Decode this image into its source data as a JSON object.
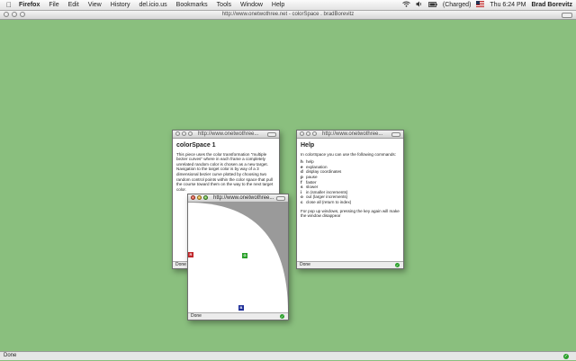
{
  "menubar": {
    "apple_icon": "",
    "items": [
      "Firefox",
      "File",
      "Edit",
      "View",
      "History",
      "del.icio.us",
      "Bookmarks",
      "Tools",
      "Window",
      "Help"
    ],
    "battery": "(Charged)",
    "clock": "Thu 6:24 PM",
    "user": "Brad Borevitz"
  },
  "main_window": {
    "title": "http://www.onetwothree.net - colorSpace . bradBorevitz",
    "status": "Done"
  },
  "info_popup": {
    "url": "http://www.onetwothree...",
    "heading": "colorSpace 1",
    "body": "This piece uses the color transformation \"multiple bezier curves\" where in each frame a completely unrelated random color is chosen as a new target. Navigation to the target color is by way of a 3 dimensional bezier curve plotted by choosing two random control points within the color space that pull the course toward them on the way to the next target color.",
    "status": "Done"
  },
  "help_popup": {
    "url": "http://www.onetwothree...",
    "heading": "Help",
    "intro": "In colorSpace you can use the following commands:",
    "commands": [
      {
        "key": "h",
        "desc": "help"
      },
      {
        "key": "e",
        "desc": "explanation"
      },
      {
        "key": "d",
        "desc": "display coordinates"
      },
      {
        "key": "p",
        "desc": "pause"
      },
      {
        "key": "f",
        "desc": "faster"
      },
      {
        "key": "s",
        "desc": "slower"
      },
      {
        "key": "i",
        "desc": "in (smaller increments)"
      },
      {
        "key": "o",
        "desc": "out (larger increments)"
      },
      {
        "key": "c",
        "desc": "close all (return to index)"
      }
    ],
    "footer": "For pop up windows, pressing the key again will make the window disappear",
    "status": "Done"
  },
  "color_popup": {
    "url": "http://www.onetwothree...",
    "markers": [
      {
        "label": "R",
        "color": "#c0262a"
      },
      {
        "label": "G",
        "color": "#2aa02a"
      },
      {
        "label": "B",
        "color": "#1f2f99"
      }
    ],
    "status": "Done"
  },
  "colors": {
    "desktop": "#8abf7e",
    "canvas_gray": "#9a9a9a"
  }
}
